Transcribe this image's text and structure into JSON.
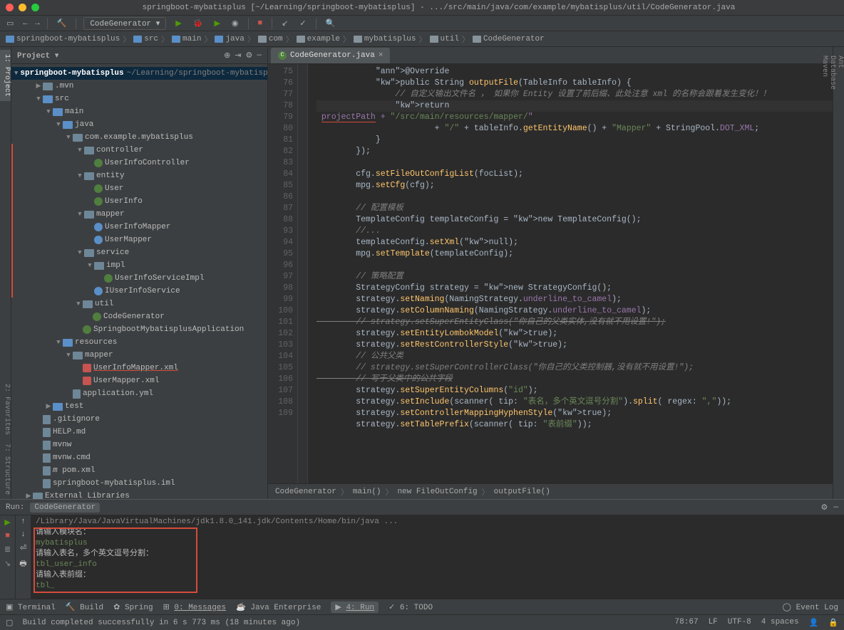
{
  "window": {
    "title": "springboot-mybatisplus [~/Learning/springboot-mybatisplus] - .../src/main/java/com/example/mybatisplus/util/CodeGenerator.java"
  },
  "toolbar": {
    "config": "CodeGenerator"
  },
  "breadcrumbs": {
    "items": [
      "springboot-mybatisplus",
      "src",
      "main",
      "java",
      "com",
      "example",
      "mybatisplus",
      "util",
      "CodeGenerator"
    ]
  },
  "sidebar": {
    "header": "Project",
    "root": {
      "name": "springboot-mybatisplus",
      "path": "~/Learning/springboot-mybatisplus"
    },
    "tree": [
      {
        "i": 1,
        "arw": "▶",
        "ic": "fold",
        "t": ".mvn"
      },
      {
        "i": 1,
        "arw": "▼",
        "ic": "fold b",
        "t": "src"
      },
      {
        "i": 2,
        "arw": "▼",
        "ic": "fold b",
        "t": "main"
      },
      {
        "i": 3,
        "arw": "▼",
        "ic": "fold b",
        "t": "java"
      },
      {
        "i": 4,
        "arw": "▼",
        "ic": "fold",
        "t": "com.example.mybatisplus"
      },
      {
        "i": 5,
        "arw": "▼",
        "ic": "fold",
        "t": "controller",
        "red": true
      },
      {
        "i": 6,
        "arw": "",
        "ic": "cls",
        "t": "UserInfoController",
        "red": true
      },
      {
        "i": 5,
        "arw": "▼",
        "ic": "fold",
        "t": "entity",
        "red": true
      },
      {
        "i": 6,
        "arw": "",
        "ic": "cls",
        "t": "User",
        "red": true
      },
      {
        "i": 6,
        "arw": "",
        "ic": "cls",
        "t": "UserInfo",
        "red": true
      },
      {
        "i": 5,
        "arw": "▼",
        "ic": "fold",
        "t": "mapper",
        "red": true
      },
      {
        "i": 6,
        "arw": "",
        "ic": "int",
        "t": "UserInfoMapper",
        "red": true
      },
      {
        "i": 6,
        "arw": "",
        "ic": "int",
        "t": "UserMapper",
        "red": true
      },
      {
        "i": 5,
        "arw": "▼",
        "ic": "fold",
        "t": "service",
        "red": true
      },
      {
        "i": 6,
        "arw": "▼",
        "ic": "fold",
        "t": "impl",
        "red": true
      },
      {
        "i": 7,
        "arw": "",
        "ic": "cls",
        "t": "UserInfoServiceImpl",
        "red": true
      },
      {
        "i": 6,
        "arw": "",
        "ic": "int",
        "t": "IUserInfoService",
        "red": true
      },
      {
        "i": 5,
        "arw": "▼",
        "ic": "fold",
        "t": "util"
      },
      {
        "i": 6,
        "arw": "",
        "ic": "cls",
        "t": "CodeGenerator"
      },
      {
        "i": 5,
        "arw": "",
        "ic": "cls",
        "t": "SpringbootMybatisplusApplication"
      },
      {
        "i": 3,
        "arw": "▼",
        "ic": "fold b",
        "t": "resources"
      },
      {
        "i": 4,
        "arw": "▼",
        "ic": "fold",
        "t": "mapper"
      },
      {
        "i": 5,
        "arw": "",
        "ic": "xml",
        "t": "UserInfoMapper.xml",
        "redu": true
      },
      {
        "i": 5,
        "arw": "",
        "ic": "xml",
        "t": "UserMapper.xml"
      },
      {
        "i": 4,
        "arw": "",
        "ic": "file",
        "t": "application.yml"
      },
      {
        "i": 2,
        "arw": "▶",
        "ic": "fold b",
        "t": "test"
      },
      {
        "i": 1,
        "arw": "",
        "ic": "file",
        "t": ".gitignore"
      },
      {
        "i": 1,
        "arw": "",
        "ic": "file",
        "t": "HELP.md"
      },
      {
        "i": 1,
        "arw": "",
        "ic": "file",
        "t": "mvnw"
      },
      {
        "i": 1,
        "arw": "",
        "ic": "file",
        "t": "mvnw.cmd"
      },
      {
        "i": 1,
        "arw": "",
        "ic": "file",
        "t": "pom.xml",
        "m": true
      },
      {
        "i": 1,
        "arw": "",
        "ic": "file",
        "t": "springboot-mybatisplus.iml"
      },
      {
        "i": 0,
        "arw": "▶",
        "ic": "fold",
        "t": "External Libraries"
      }
    ]
  },
  "editor": {
    "tab": "CodeGenerator.java",
    "crumb": [
      "CodeGenerator",
      "main()",
      "new FileOutConfig",
      "outputFile()"
    ],
    "lines": [
      {
        "n": 75,
        "h": "            @Override",
        "cls": "ann"
      },
      {
        "n": 76,
        "h": "            public String outputFile(TableInfo tableInfo) {"
      },
      {
        "n": 77,
        "h": "                // 自定义输出文件名 ， 如果你 Entity 设置了前后缀、此处注意 xml 的名称会跟着发生变化！！",
        "cmt": true
      },
      {
        "n": 78,
        "h": "                return projectPath + \"/src/main/resources/mapper/\"",
        "hl": true,
        "r": true
      },
      {
        "n": 79,
        "h": "                        + \"/\" + tableInfo.getEntityName() + \"Mapper\" + StringPool.DOT_XML;"
      },
      {
        "n": 80,
        "h": "            }"
      },
      {
        "n": 81,
        "h": "        });"
      },
      {
        "n": 82,
        "h": ""
      },
      {
        "n": 83,
        "h": "        cfg.setFileOutConfigList(focList);"
      },
      {
        "n": 84,
        "h": "        mpg.setCfg(cfg);"
      },
      {
        "n": 85,
        "h": ""
      },
      {
        "n": 86,
        "h": "        // 配置模板",
        "cmt": true
      },
      {
        "n": 87,
        "h": "        TemplateConfig templateConfig = new TemplateConfig();"
      },
      {
        "n": 88,
        "h": "        //...",
        "cmt": true
      },
      {
        "n": 93,
        "h": "        templateConfig.setXml(null);"
      },
      {
        "n": 94,
        "h": "        mpg.setTemplate(templateConfig);"
      },
      {
        "n": 95,
        "h": ""
      },
      {
        "n": 96,
        "h": "        // 策略配置",
        "cmt": true
      },
      {
        "n": 97,
        "h": "        StrategyConfig strategy = new StrategyConfig();"
      },
      {
        "n": 98,
        "h": "        strategy.setNaming(NamingStrategy.underline_to_camel);"
      },
      {
        "n": 99,
        "h": "        strategy.setColumnNaming(NamingStrategy.underline_to_camel);"
      },
      {
        "n": 100,
        "h": "        // strategy.setSuperEntityClass(\"你自己的父类实体,没有就不用设置!\");",
        "cmt": true,
        "strike": true
      },
      {
        "n": 101,
        "h": "        strategy.setEntityLombokModel(true);"
      },
      {
        "n": 102,
        "h": "        strategy.setRestControllerStyle(true);"
      },
      {
        "n": 103,
        "h": "        // 公共父类",
        "cmt": true
      },
      {
        "n": 104,
        "h": "        // strategy.setSuperControllerClass(\"你自己的父类控制器,没有就不用设置!\");",
        "cmt": true
      },
      {
        "n": 105,
        "h": "        // 写于父类中的公共字段",
        "cmt": true,
        "strike": true
      },
      {
        "n": 106,
        "h": "        strategy.setSuperEntityColumns(\"id\");"
      },
      {
        "n": 107,
        "h": "        strategy.setInclude(scanner( tip: \"表名，多个英文逗号分割\").split( regex: \",\"));"
      },
      {
        "n": 108,
        "h": "        strategy.setControllerMappingHyphenStyle(true);"
      },
      {
        "n": 109,
        "h": "        strategy.setTablePrefix(scanner( tip: \"表前缀\"));"
      }
    ]
  },
  "run": {
    "title": "Run:",
    "config": "CodeGenerator",
    "lines": [
      {
        "t": "/Library/Java/JavaVirtualMachines/jdk1.8.0_141.jdk/Contents/Home/bin/java ...",
        "c": "cc"
      },
      {
        "t": "请输入模块名：",
        "c": ""
      },
      {
        "t": "mybatisplus",
        "c": "cg"
      },
      {
        "t": "请输入表名，多个英文逗号分割：",
        "c": ""
      },
      {
        "t": "tbl_user_info",
        "c": "cg"
      },
      {
        "t": "请输入表前缀：",
        "c": ""
      },
      {
        "t": "tbl_",
        "c": "cg"
      }
    ]
  },
  "bottombar": {
    "items": [
      "Terminal",
      "Build",
      "Spring",
      "0: Messages",
      "Java Enterprise",
      "4: Run",
      "6: TODO"
    ],
    "eventlog": "Event Log"
  },
  "status": {
    "msg": "Build completed successfully in 6 s 773 ms (18 minutes ago)",
    "pos": "78:67",
    "le": "LF",
    "enc": "UTF-8",
    "indent": "4 spaces"
  },
  "left_tabs": [
    "1: Project",
    "2: Favorites",
    "7: Structure"
  ],
  "right_tabs": [
    "Ant",
    "Database",
    "Maven"
  ]
}
